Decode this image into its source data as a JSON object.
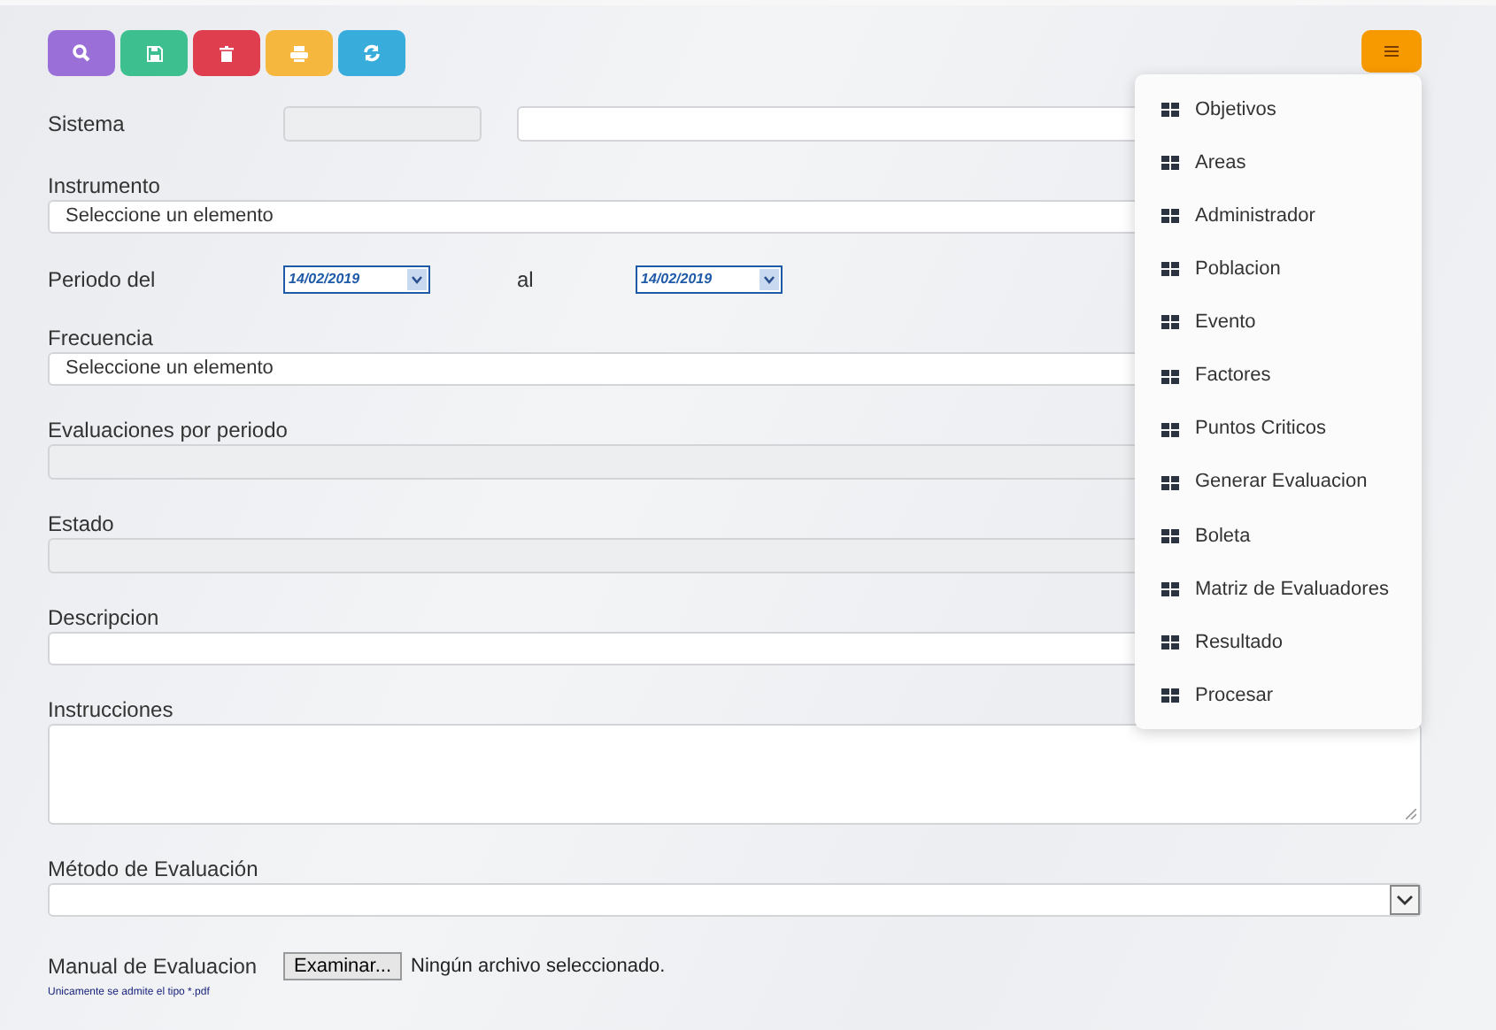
{
  "toolbar": {
    "buttons": [
      {
        "kind": "search",
        "color": "#9b6fd8"
      },
      {
        "kind": "save",
        "color": "#3dbf8f"
      },
      {
        "kind": "delete",
        "color": "#df3e4e"
      },
      {
        "kind": "print",
        "color": "#f5b73d"
      },
      {
        "kind": "refresh",
        "color": "#38addc"
      }
    ]
  },
  "menu": {
    "items": [
      {
        "label": "Objetivos"
      },
      {
        "label": "Areas"
      },
      {
        "label": "Administrador"
      },
      {
        "label": "Poblacion"
      },
      {
        "label": "Evento"
      },
      {
        "label": "Factores"
      },
      {
        "label": "Puntos Criticos"
      },
      {
        "label": "Generar Evaluacion"
      },
      {
        "label": "Boleta"
      },
      {
        "label": "Matriz de Evaluadores"
      },
      {
        "label": "Resultado"
      },
      {
        "label": "Procesar"
      }
    ]
  },
  "form": {
    "sistema": {
      "label": "Sistema"
    },
    "instrumento": {
      "label": "Instrumento",
      "value": "Seleccione un elemento"
    },
    "periodo": {
      "label": "Periodo del",
      "from": "14/02/2019",
      "to_label": "al",
      "to": "14/02/2019"
    },
    "frecuencia": {
      "label": "Frecuencia",
      "value": "Seleccione un elemento"
    },
    "evaluaciones": {
      "label": "Evaluaciones por periodo"
    },
    "estado": {
      "label": "Estado"
    },
    "descripcion": {
      "label": "Descripcion"
    },
    "instrucciones": {
      "label": "Instrucciones"
    },
    "metodo": {
      "label": "Método de Evaluación"
    },
    "manual": {
      "label": "Manual de Evaluacion",
      "button": "Examinar...",
      "status": "Ningún archivo seleccionado.",
      "hint": "Unicamente se admite el tipo *.pdf"
    }
  }
}
